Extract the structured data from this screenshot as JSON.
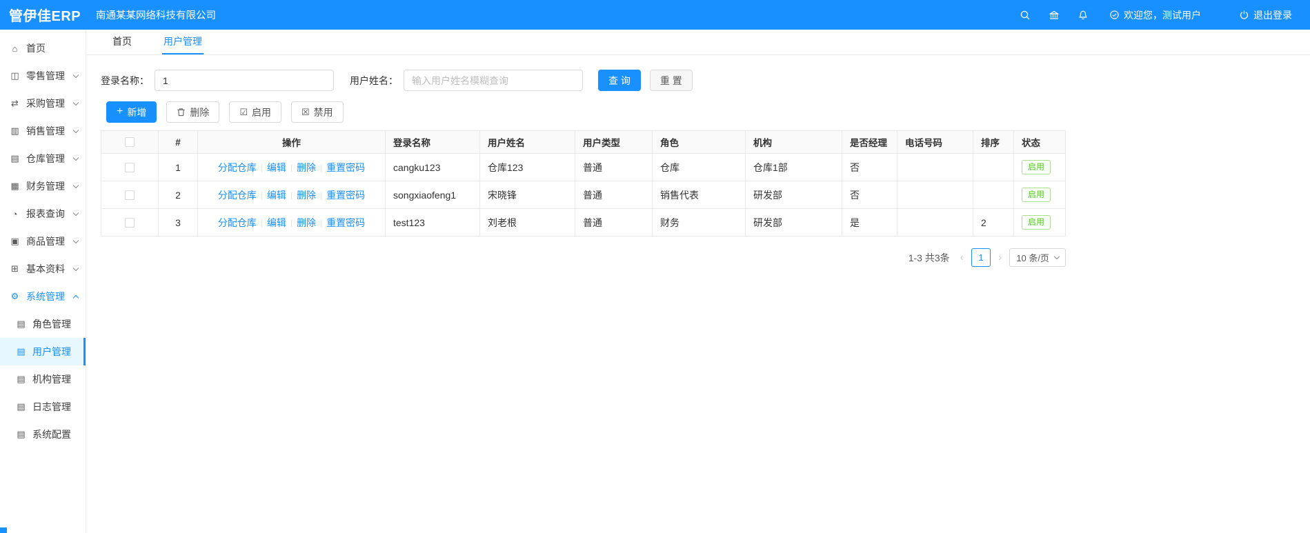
{
  "colors": {
    "accent": "#1890ff",
    "success": "#52c41a"
  },
  "topbar": {
    "logo": "管伊佳ERP",
    "company": "南通某某网络科技有限公司",
    "welcome": "欢迎您，测试用户",
    "logout": "退出登录"
  },
  "tabs": [
    {
      "label": "首页",
      "active": false
    },
    {
      "label": "用户管理",
      "active": true
    }
  ],
  "sidebar": {
    "items": [
      {
        "label": "首页",
        "icon": "home-icon",
        "glyph": "⌂",
        "expandable": false
      },
      {
        "label": "零售管理",
        "icon": "retail-icon",
        "glyph": "◫",
        "expandable": true
      },
      {
        "label": "采购管理",
        "icon": "purchase-icon",
        "glyph": "⇄",
        "expandable": true
      },
      {
        "label": "销售管理",
        "icon": "sales-icon",
        "glyph": "▥",
        "expandable": true
      },
      {
        "label": "仓库管理",
        "icon": "warehouse-icon",
        "glyph": "▤",
        "expandable": true
      },
      {
        "label": "财务管理",
        "icon": "finance-icon",
        "glyph": "▦",
        "expandable": true
      },
      {
        "label": "报表查询",
        "icon": "report-icon",
        "glyph": "◔",
        "expandable": true
      },
      {
        "label": "商品管理",
        "icon": "goods-icon",
        "glyph": "▣",
        "expandable": true
      },
      {
        "label": "基本资料",
        "icon": "basic-data-icon",
        "glyph": "⊞",
        "expandable": true
      },
      {
        "label": "系统管理",
        "icon": "gear-icon",
        "glyph": "⚙",
        "expandable": true,
        "expanded": true
      }
    ],
    "subitems": [
      {
        "label": "角色管理",
        "icon": "doc-icon",
        "glyph": "▤",
        "active": false
      },
      {
        "label": "用户管理",
        "icon": "doc-icon",
        "glyph": "▤",
        "active": true
      },
      {
        "label": "机构管理",
        "icon": "doc-icon",
        "glyph": "▤",
        "active": false
      },
      {
        "label": "日志管理",
        "icon": "doc-icon",
        "glyph": "▤",
        "active": false
      },
      {
        "label": "系统配置",
        "icon": "doc-icon",
        "glyph": "▤",
        "active": false
      }
    ]
  },
  "filters": {
    "login_name_label": "登录名称：",
    "login_name_value": "1",
    "user_name_label": "用户姓名：",
    "user_name_placeholder": "输入用户姓名模糊查询",
    "search_label": "查 询",
    "reset_label": "重 置"
  },
  "toolbar": {
    "add_label": "新增",
    "add_icon_glyph": "+",
    "delete_label": "删除",
    "enable_label": "启用",
    "enable_icon_glyph": "☑",
    "disable_label": "禁用",
    "disable_icon_glyph": "☒"
  },
  "table": {
    "headers": [
      "#",
      "操作",
      "登录名称",
      "用户姓名",
      "用户类型",
      "角色",
      "机构",
      "是否经理",
      "电话号码",
      "排序",
      "状态"
    ],
    "action_links": [
      "分配仓库",
      "编辑",
      "删除",
      "重置密码"
    ],
    "rows": [
      {
        "index": "1",
        "login": "cangku123",
        "name": "仓库123",
        "type": "普通",
        "role": "仓库",
        "org": "仓库1部",
        "manager": "否",
        "phone": "",
        "sort": "",
        "status": "启用"
      },
      {
        "index": "2",
        "login": "songxiaofeng1",
        "name": "宋晓锋",
        "type": "普通",
        "role": "销售代表",
        "org": "研发部",
        "manager": "否",
        "phone": "",
        "sort": "",
        "status": "启用"
      },
      {
        "index": "3",
        "login": "test123",
        "name": "刘老根",
        "type": "普通",
        "role": "财务",
        "org": "研发部",
        "manager": "是",
        "phone": "",
        "sort": "2",
        "status": "启用"
      }
    ]
  },
  "pagination": {
    "total_text": "1-3 共3条",
    "prev_glyph": "‹",
    "current_page": "1",
    "next_glyph": "›",
    "page_size": "10 条/页"
  }
}
